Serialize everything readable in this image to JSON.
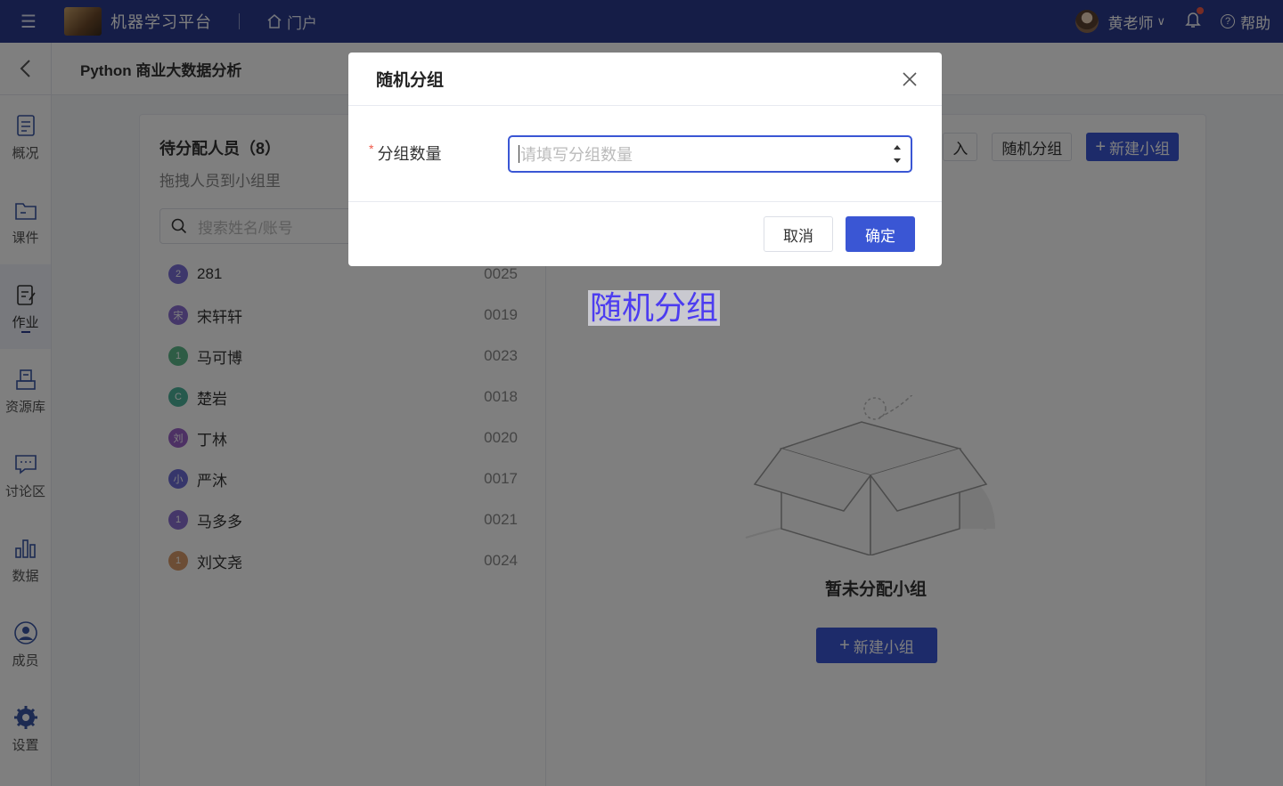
{
  "topbar": {
    "app_title": "机器学习平台",
    "portal_label": "门户",
    "username": "黄老师",
    "help_label": "帮助"
  },
  "header": {
    "course_title": "Python 商业大数据分析"
  },
  "sidebar": {
    "items": [
      {
        "label": "概况",
        "icon": "overview-icon"
      },
      {
        "label": "课件",
        "icon": "folder-icon"
      },
      {
        "label": "作业",
        "icon": "assignment-icon",
        "active": true
      },
      {
        "label": "资源库",
        "icon": "resource-icon"
      },
      {
        "label": "讨论区",
        "icon": "discussion-icon"
      },
      {
        "label": "数据",
        "icon": "data-icon"
      },
      {
        "label": "成员",
        "icon": "member-icon"
      },
      {
        "label": "设置",
        "icon": "settings-icon"
      }
    ]
  },
  "unassigned": {
    "title": "待分配人员（8）",
    "subtitle": "拖拽人员到小组里",
    "search_placeholder": "搜索姓名/账号",
    "people": [
      {
        "avatar": "2",
        "name": "281",
        "id": "0025",
        "color": "#7b6fd6"
      },
      {
        "avatar": "宋",
        "name": "宋轩轩",
        "id": "0019",
        "color": "#8a6fd2"
      },
      {
        "avatar": "1",
        "name": "马可博",
        "id": "0023",
        "color": "#5cb88a"
      },
      {
        "avatar": "C",
        "name": "楚岩",
        "id": "0018",
        "color": "#4cb39a"
      },
      {
        "avatar": "刘",
        "name": "丁林",
        "id": "0020",
        "color": "#9a62c8"
      },
      {
        "avatar": "小",
        "name": "严沐",
        "id": "0017",
        "color": "#6c6cd6"
      },
      {
        "avatar": "1",
        "name": "马多多",
        "id": "0021",
        "color": "#8a6fd2"
      },
      {
        "avatar": "1",
        "name": "刘文尧",
        "id": "0024",
        "color": "#d99a6a"
      }
    ]
  },
  "groups": {
    "import_label": "入",
    "random_group_label": "随机分组",
    "new_group_label": "新建小组",
    "empty_text": "暂未分配小组",
    "empty_button_label": "新建小组"
  },
  "highlight_label": "随机分组",
  "modal": {
    "title": "随机分组",
    "field_label": "分组数量",
    "field_placeholder": "请填写分组数量",
    "cancel_label": "取消",
    "ok_label": "确定"
  }
}
